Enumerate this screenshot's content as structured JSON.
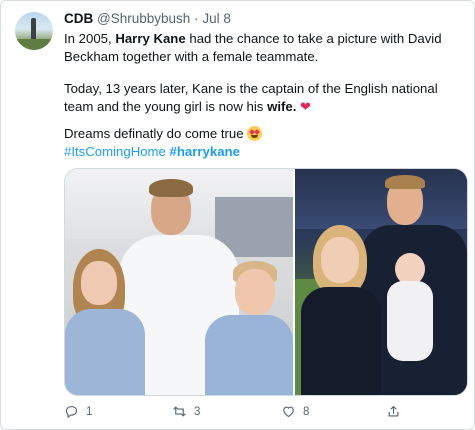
{
  "author": {
    "name": "CDB",
    "handle": "@Shrubbybush",
    "separator": "·",
    "date": "Jul 8"
  },
  "tweet": {
    "line1_a": "In 2005, ",
    "line1_b": "Harry Kane",
    "line1_c": "  had the chance to take a picture with David Beckham  together with a female teammate.",
    "line2_a": "Today, 13 years later, Kane is the captain of the English national team and the young girl is now his ",
    "line2_b": "wife.",
    "heart": "❤",
    "line3": "Dreams definatly do come true ",
    "hashtag1": "#ItsComingHome",
    "hashtag2": "#harrykane"
  },
  "media": {
    "left_photo": "2005 photo: Beckham with two kids",
    "right_photo": "Kane with wife and baby"
  },
  "actions": {
    "reply_count": "1",
    "retweet_count": "3",
    "like_count": "8"
  },
  "colors": {
    "link": "#1d9bf0",
    "heart": "#e0245e",
    "secondary_text": "#536471"
  }
}
